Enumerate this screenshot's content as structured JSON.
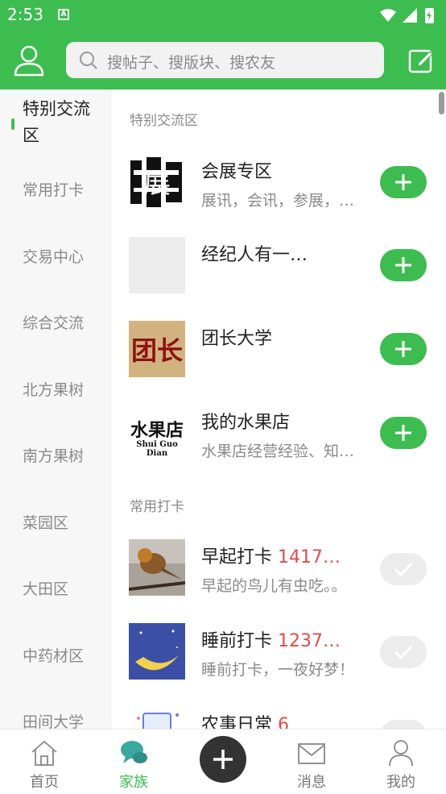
{
  "status": {
    "time": "2:53",
    "sim_label": "A"
  },
  "search": {
    "placeholder": "搜帖子、搜版块、搜农友"
  },
  "sidebar": {
    "items": [
      {
        "label": "特别交流区"
      },
      {
        "label": "常用打卡"
      },
      {
        "label": "交易中心"
      },
      {
        "label": "综合交流"
      },
      {
        "label": "北方果树"
      },
      {
        "label": "南方果树"
      },
      {
        "label": "菜园区"
      },
      {
        "label": "大田区"
      },
      {
        "label": "中药材区"
      },
      {
        "label": "田间大学"
      }
    ]
  },
  "sections": [
    {
      "title": "特别交流区",
      "rows": [
        {
          "title": "会展专区",
          "desc": "展讯，会讯，参展，…",
          "button": "add"
        },
        {
          "title": "经纪人有一…",
          "desc": "",
          "button": "add"
        },
        {
          "title": "团长大学",
          "desc": "",
          "button": "add"
        },
        {
          "title": "我的水果店",
          "desc": "水果店经营经验、知…",
          "button": "add",
          "thumb_text": "水果店",
          "thumb_sub": "Shui Guo Dian"
        }
      ]
    },
    {
      "title": "常用打卡",
      "rows": [
        {
          "title": "早起打卡",
          "count": "1417…",
          "desc": "早起的鸟儿有虫吃。。",
          "button": "done"
        },
        {
          "title": "睡前打卡",
          "count": "1237…",
          "desc": "睡前打卡，一夜好梦！",
          "button": "done"
        },
        {
          "title": "农事日常",
          "count": "6",
          "desc": "",
          "button": "done"
        }
      ]
    }
  ],
  "thumbs": {
    "expo_text": "展",
    "tuan_text": "团长"
  },
  "tabs": [
    {
      "label": "首页"
    },
    {
      "label": "家族"
    },
    {
      "label": "消息"
    },
    {
      "label": "我的"
    }
  ],
  "colors": {
    "brand": "#3dbc50",
    "count": "#e24b4b"
  }
}
